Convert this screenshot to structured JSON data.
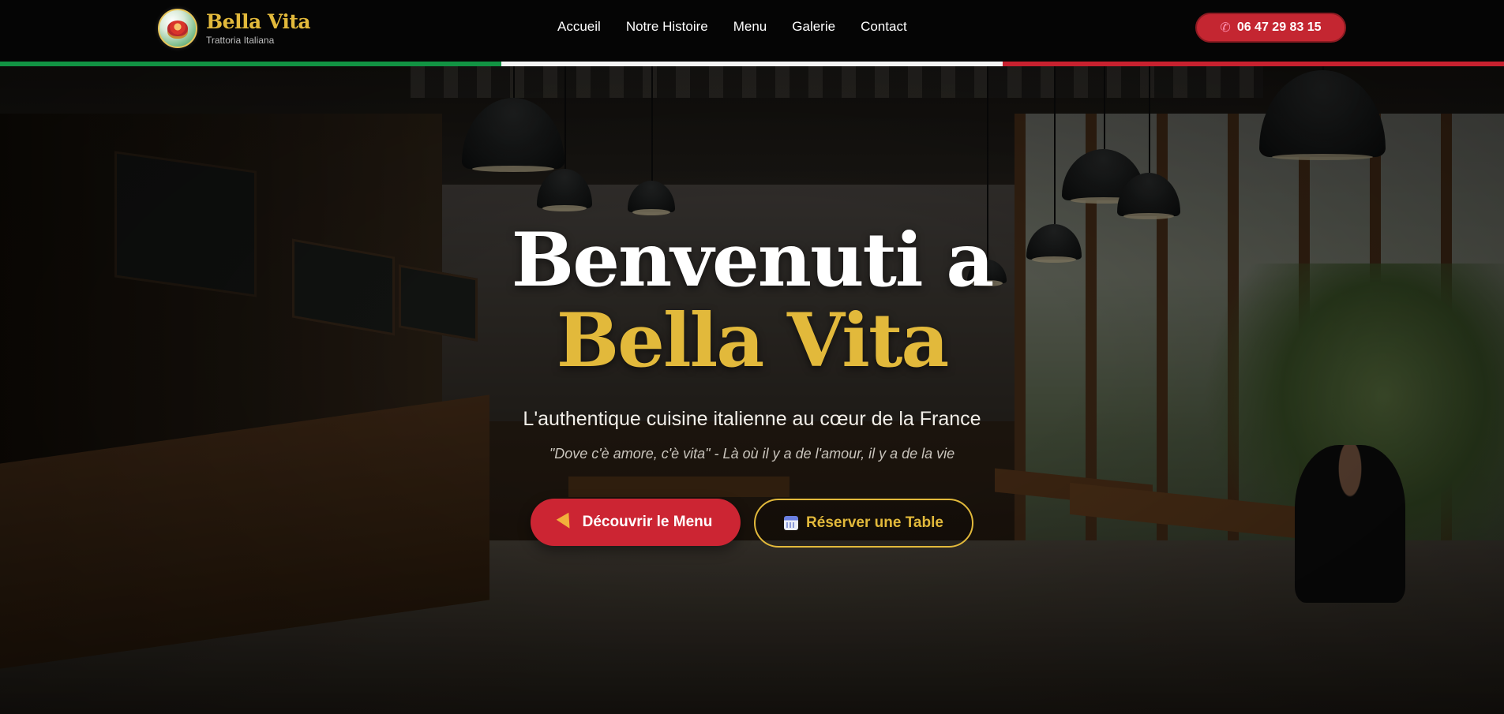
{
  "brand": {
    "name": "Bella Vita",
    "tagline": "Trattoria Italiana"
  },
  "nav": {
    "links": [
      "Accueil",
      "Notre Histoire",
      "Menu",
      "Galerie",
      "Contact"
    ]
  },
  "phone": {
    "label": "06 47 29 83 15",
    "icon": "phone-icon"
  },
  "flag_colors": [
    "#129343",
    "#f4f4f4",
    "#c8212f"
  ],
  "hero": {
    "title_line1": "Benvenuti a",
    "title_line2": "Bella Vita",
    "subtitle": "L'authentique cuisine italienne au cœur de la France",
    "quote": "\"Dove c'è amore, c'è vita\" - Là où il y a de l'amour, il y a de la vie",
    "primary_button": {
      "label": "Découvrir le Menu",
      "icon": "pizza-icon"
    },
    "secondary_button": {
      "label": "Réserver une Table",
      "icon": "calendar-icon"
    }
  },
  "colors": {
    "gold": "#e2b93b",
    "red": "#cc2533",
    "navbar": "#050505"
  }
}
